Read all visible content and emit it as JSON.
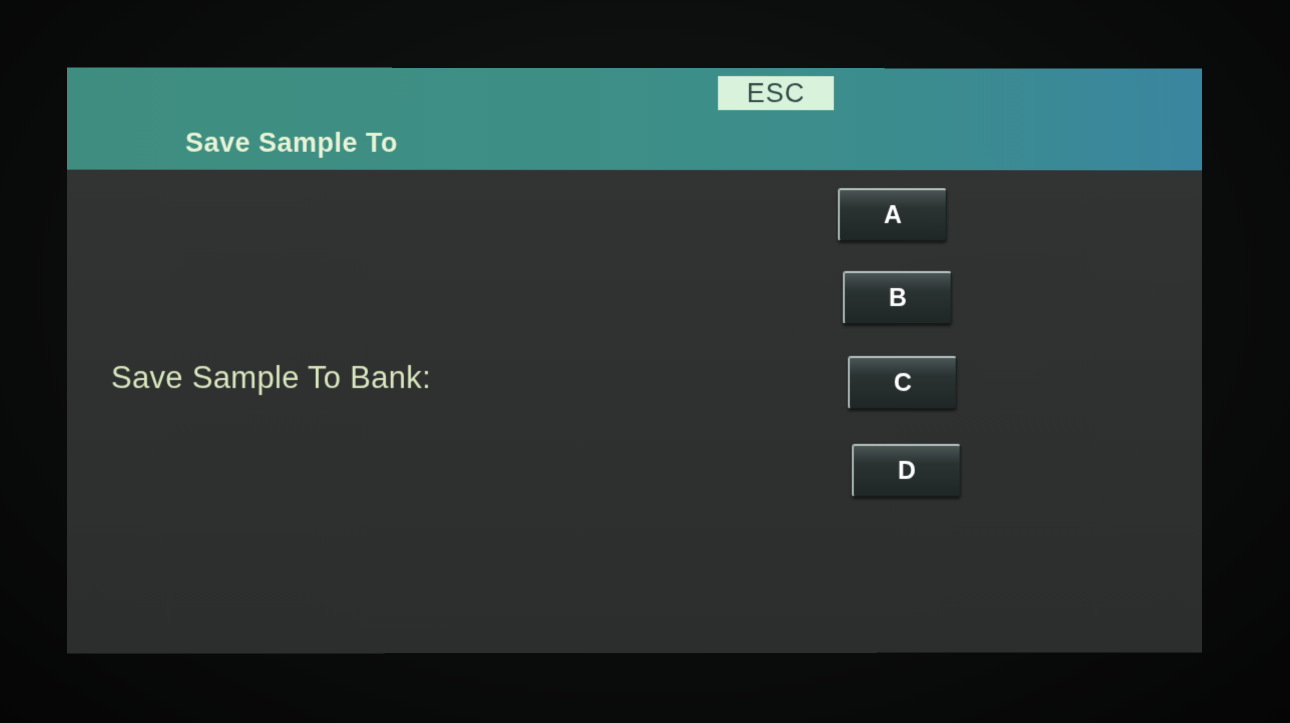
{
  "header": {
    "esc_label": "ESC",
    "title": "Save Sample To"
  },
  "main": {
    "label": "Save Sample To Bank:",
    "banks": [
      "A",
      "B",
      "C",
      "D"
    ]
  },
  "colors": {
    "header_teal": "#3d8f86",
    "esc_background": "#d9f2dc",
    "label_text": "#d9e6be",
    "screen_background": "#313333"
  }
}
